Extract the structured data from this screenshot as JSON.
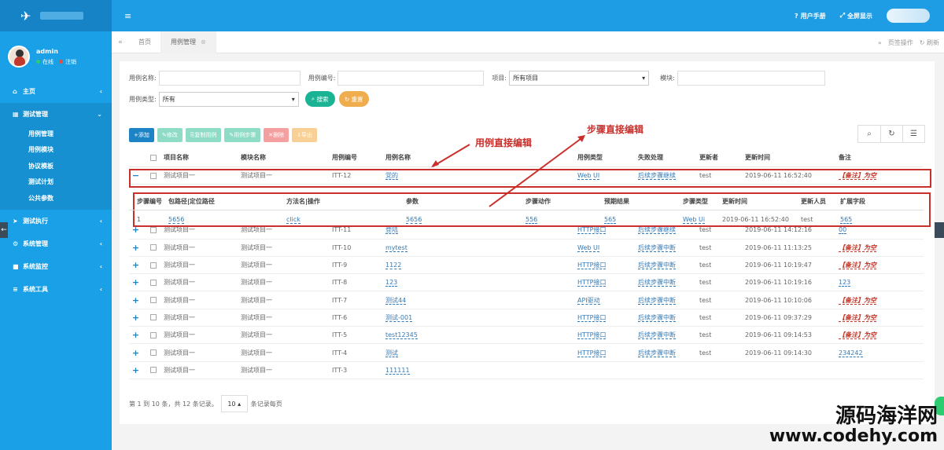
{
  "sidebar": {
    "user": {
      "name": "admin",
      "online": "在线",
      "logout": "注销"
    },
    "menu": [
      {
        "label": "主页",
        "icon": "home-icon"
      },
      {
        "label": "测试管理",
        "icon": "table-icon"
      },
      {
        "label": "测试执行",
        "icon": "send-icon"
      },
      {
        "label": "系统管理",
        "icon": "gear-icon"
      },
      {
        "label": "系统监控",
        "icon": "video-icon"
      },
      {
        "label": "系统工具",
        "icon": "bars-icon"
      }
    ],
    "submenu": [
      "用例管理",
      "用例模块",
      "协议模板",
      "测试计划",
      "公共参数"
    ]
  },
  "topbar": {
    "manual": "用户手册",
    "fullscreen": "全屏显示"
  },
  "tabs": {
    "home": "首页",
    "active": "用例管理",
    "page_ops": "页签操作",
    "refresh": "刷新"
  },
  "filters": {
    "case_name_label": "用例名称:",
    "case_code_label": "用例编号:",
    "project_label": "项目:",
    "project_value": "所有项目",
    "module_label": "模块:",
    "case_type_label": "用例类型:",
    "case_type_value": "所有",
    "search": "搜索",
    "reset": "重置"
  },
  "toolbar": [
    "添加",
    "修改",
    "复制用例",
    "用例步骤",
    "删除",
    "导出"
  ],
  "table": {
    "headers": [
      "项目名称",
      "模块名称",
      "用例编号",
      "用例名称",
      "用例类型",
      "失败处理",
      "更新者",
      "更新时间",
      "备注"
    ],
    "expanded_row": [
      "测试项目一",
      "测试项目一",
      "ITT-12",
      "党的",
      "Web UI",
      "后续步骤继续",
      "test",
      "2019-06-11 16:52:40",
      "【备注】为空"
    ],
    "sub_headers": [
      "步骤编号",
      "包路径|定位路径",
      "方法名|操作",
      "参数",
      "步骤动作",
      "预期结果",
      "步骤类型",
      "更新时间",
      "更新人员",
      "扩展字段"
    ],
    "sub_row": [
      "1",
      "5656",
      "click",
      "5656",
      "556",
      "565",
      "Web Ui",
      "2019-06-11 16:52:40",
      "test",
      "565"
    ],
    "rows": [
      [
        "测试项目一",
        "测试项目一",
        "ITT-11",
        "登陆",
        "HTTP接口",
        "后续步骤继续",
        "test",
        "2019-06-11 14:12:16",
        "00"
      ],
      [
        "测试项目一",
        "测试项目一",
        "ITT-10",
        "mytest",
        "Web UI",
        "后续步骤中断",
        "test",
        "2019-06-11 11:13:25",
        "【备注】为空"
      ],
      [
        "测试项目一",
        "测试项目一",
        "ITT-9",
        "1122",
        "HTTP接口",
        "后续步骤中断",
        "test",
        "2019-06-11 10:19:47",
        "【备注】为空"
      ],
      [
        "测试项目一",
        "测试项目一",
        "ITT-8",
        "123",
        "HTTP接口",
        "后续步骤中断",
        "test",
        "2019-06-11 10:19:16",
        "123"
      ],
      [
        "测试项目一",
        "测试项目一",
        "ITT-7",
        "测试44",
        "API驱动",
        "后续步骤中断",
        "test",
        "2019-06-11 10:10:06",
        "【备注】为空"
      ],
      [
        "测试项目一",
        "测试项目一",
        "ITT-6",
        "测试-001",
        "HTTP接口",
        "后续步骤中断",
        "test",
        "2019-06-11 09:37:29",
        "【备注】为空"
      ],
      [
        "测试项目一",
        "测试项目一",
        "ITT-5",
        "test12345",
        "HTTP接口",
        "后续步骤中断",
        "test",
        "2019-06-11 09:14:53",
        "【备注】为空"
      ],
      [
        "测试项目一",
        "测试项目一",
        "ITT-4",
        "测试",
        "HTTP接口",
        "后续步骤中断",
        "test",
        "2019-06-11 09:14:30",
        "234242"
      ],
      [
        "测试项目一",
        "测试项目一",
        "ITT-3",
        "111111",
        "",
        "",
        "",
        "",
        ""
      ]
    ]
  },
  "annotations": {
    "case_edit": "用例直接编辑",
    "step_edit": "步骤直接编辑"
  },
  "pagination": {
    "summary": "第 1 到 10 条，共 12 条记录。",
    "page_size": "10 ▴",
    "per_page": "条记录每页"
  },
  "watermark": {
    "line1": "源码海洋网",
    "line2": "www.codehy.com"
  },
  "colors": {
    "sidebar": "#1aa0e6",
    "topbar": "#1e9ce4",
    "highlight": "#c9302c"
  }
}
